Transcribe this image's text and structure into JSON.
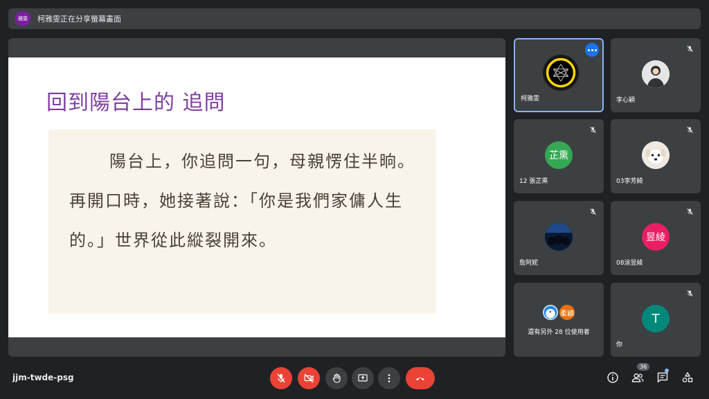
{
  "banner": {
    "badge": "雅雯",
    "text": "柯雅雯正在分享螢幕畫面"
  },
  "slide": {
    "title": "回到陽台上的 追問",
    "body": "陽台上，你追問一句，母親愣住半晌。再開口時，她接著說：「你是我們家傭人生的。」世界從此縱裂開來。"
  },
  "participants": [
    {
      "name": "柯雅雯",
      "avatar": "network-logo",
      "active": true
    },
    {
      "name": "李心穎",
      "avatar": "photo",
      "muted": true
    },
    {
      "name": "12 張芷熏",
      "avatar_text": "芷熏",
      "avatar_color": "#34a853",
      "muted": true
    },
    {
      "name": "03李芳綺",
      "avatar": "dog-photo",
      "muted": true
    },
    {
      "name": "詹阿妮",
      "avatar": "photo",
      "muted": true
    },
    {
      "name": "08涂昱綾",
      "avatar_text": "昱綾",
      "avatar_color": "#e91e63",
      "muted": true
    },
    {
      "name": "還有另外 28 位使用者",
      "avatar_text": "柔穎",
      "avatar_color": "#e8710a"
    },
    {
      "name": "你",
      "avatar_text": "T",
      "avatar_color": "#00897b",
      "muted": true
    }
  ],
  "bottom": {
    "meeting_code": "jjm-twde-psg",
    "people_count": "36"
  },
  "colors": {
    "accent": "#1a73e8",
    "danger": "#ea4335",
    "tile_bg": "#3c4043"
  }
}
